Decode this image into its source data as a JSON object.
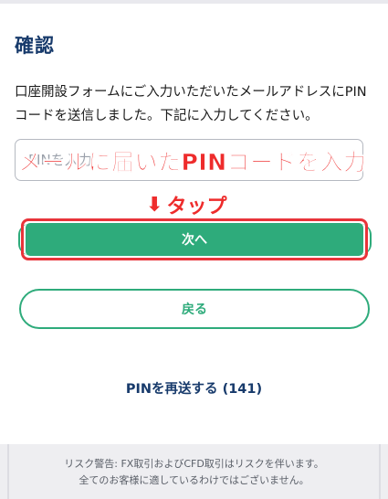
{
  "page": {
    "title": "確認",
    "description": "口座開設フォームにご入力いただいたメールアドレスにPINコードを送信しました。下記に入力してください。"
  },
  "pin_field": {
    "placeholder": "PINを入力",
    "value": ""
  },
  "annotations": {
    "instruction": "メールに届いたPINコードを入力",
    "tap": "タップ",
    "tap_arrow": "⬇"
  },
  "buttons": {
    "next_label": "次へ",
    "back_label": "戻る",
    "resend_label": "PINを再送する (141)"
  },
  "footer": {
    "line1": "リスク警告: FX取引およびCFD取引はリスクを伴います。",
    "line2": "全てのお客様に適しているわけではございません。"
  },
  "colors": {
    "title": "#173a6b",
    "primary_green": "#2eab7b",
    "annotation_red": "#ee2c2c",
    "footer_bg": "#eeeef1"
  }
}
